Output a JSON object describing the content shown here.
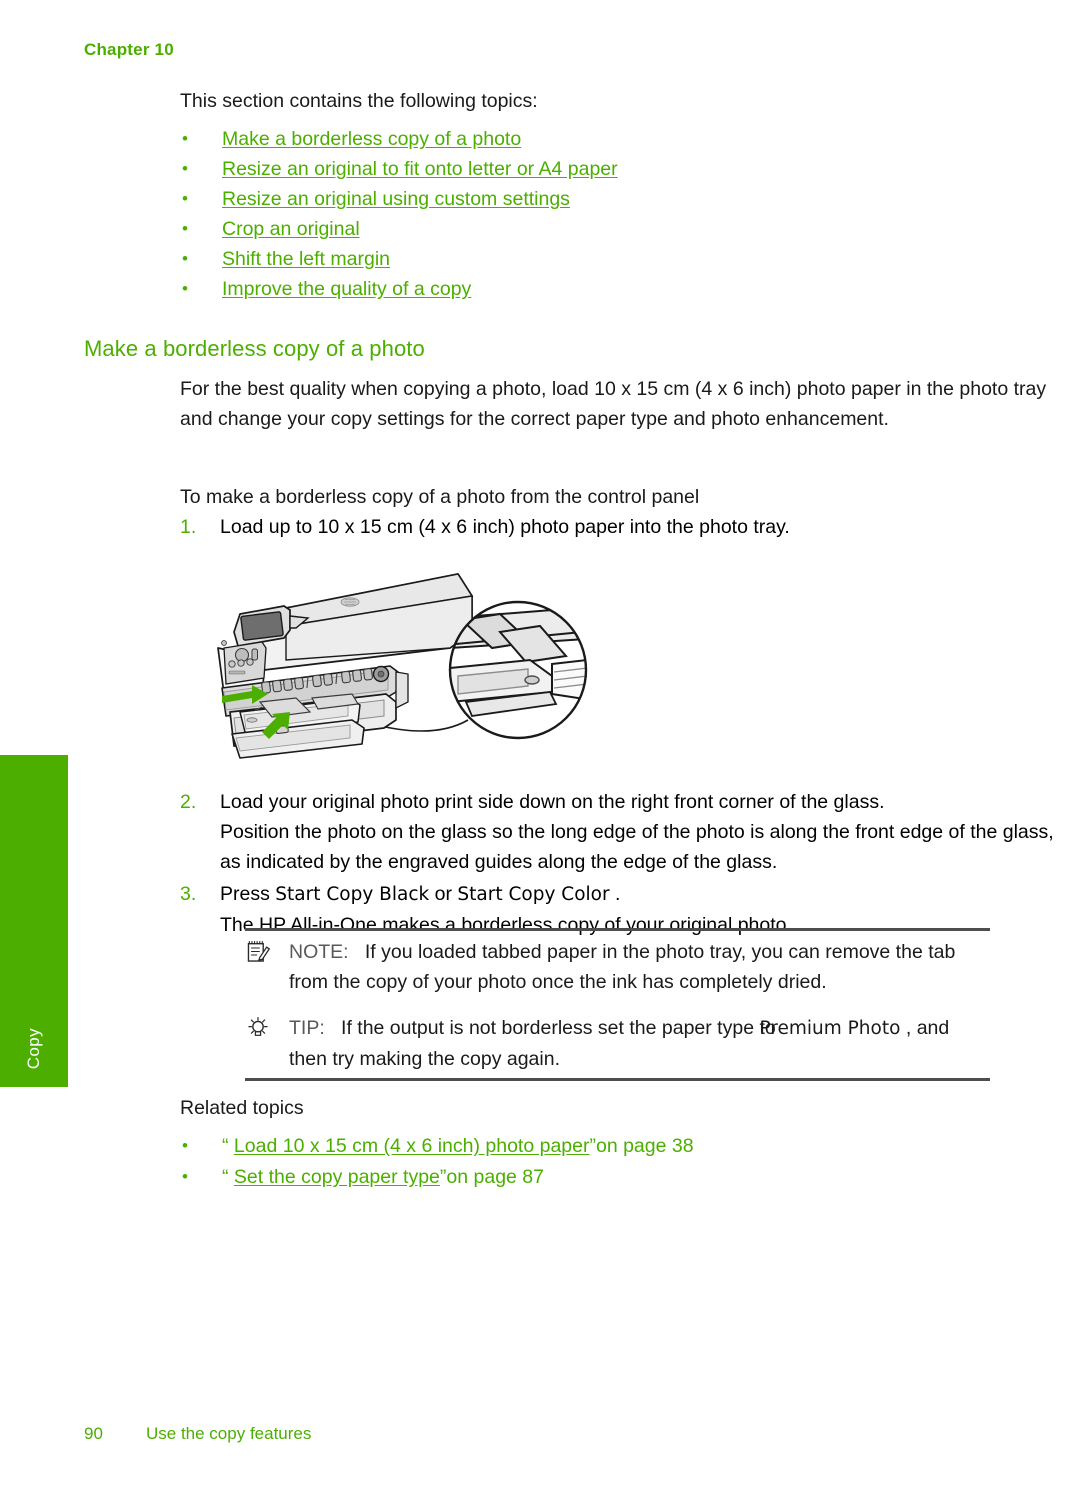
{
  "page": {
    "chapter_label": "Chapter 10",
    "side_tab_label": "Copy",
    "accent_color": "#4CAF00",
    "rule_color": "#4d4d4d"
  },
  "intro": {
    "lead": "This section contains the following topics:",
    "topics": [
      "Make a borderless copy of a photo",
      "Resize an original to fit onto letter or A4 paper",
      "Resize an original using custom settings",
      "Crop an original",
      "Shift the left margin",
      "Improve the quality of a copy"
    ]
  },
  "section": {
    "heading": "Make a borderless copy of a photo",
    "paragraph": "For the best quality when copying a photo, load 10 x 15 cm (4 x 6 inch) photo paper in the photo tray and change your copy settings for the correct paper type and photo enhancement.",
    "procedure_title": "To make a borderless copy of a photo from the control panel",
    "steps": [
      {
        "number": "1.",
        "text": "Load up to 10 x 15 cm (4 x 6 inch) photo paper into the photo tray."
      },
      {
        "number": "2.",
        "text": "Load your original photo print side down on the right front corner of the glass.",
        "sub": "Position the photo on the glass so the long edge of the photo is along the front edge of the glass, as indicated by the engraved guides along the edge of the glass."
      },
      {
        "number": "3.",
        "text_before": "Press ",
        "button_black": "Start Copy Black",
        "text_middle": " or ",
        "button_color": "Start Copy Color",
        "text_after": " .",
        "sub": "The HP All-in-One makes a borderless copy of your original photo."
      }
    ]
  },
  "admonitions": [
    {
      "icon": "note-icon",
      "keyword": "NOTE:",
      "text": "If you loaded tabbed paper in the photo tray, you can remove the tab from the copy of your photo once the ink has completely dried."
    },
    {
      "icon": "lightbulb-icon",
      "keyword": "TIP:",
      "text_before": "If the output is not borderless set the paper type ",
      "overlap_word": "to",
      "emphasis": "Premium Photo",
      "text_after": " , and then try making the copy again."
    }
  ],
  "related": {
    "title": "Related topics",
    "items": [
      {
        "open_quote": "“",
        "link": "Load 10 x 15 cm (4 x 6 inch) photo paper",
        "close_quote": "”",
        "page_ref": "on page 38"
      },
      {
        "open_quote": "“",
        "link": "Set the copy paper type",
        "close_quote": "”",
        "page_ref": "on page 87"
      }
    ]
  },
  "figure": {
    "name": "hp-all-in-one-photo-tray-illustration",
    "caption_hidden": "Line drawing of HP All-in-One printer with photo tray extended and magnified callout of the paper-width guide"
  },
  "footer": {
    "page_number": "90",
    "running_title": "Use the copy features"
  }
}
